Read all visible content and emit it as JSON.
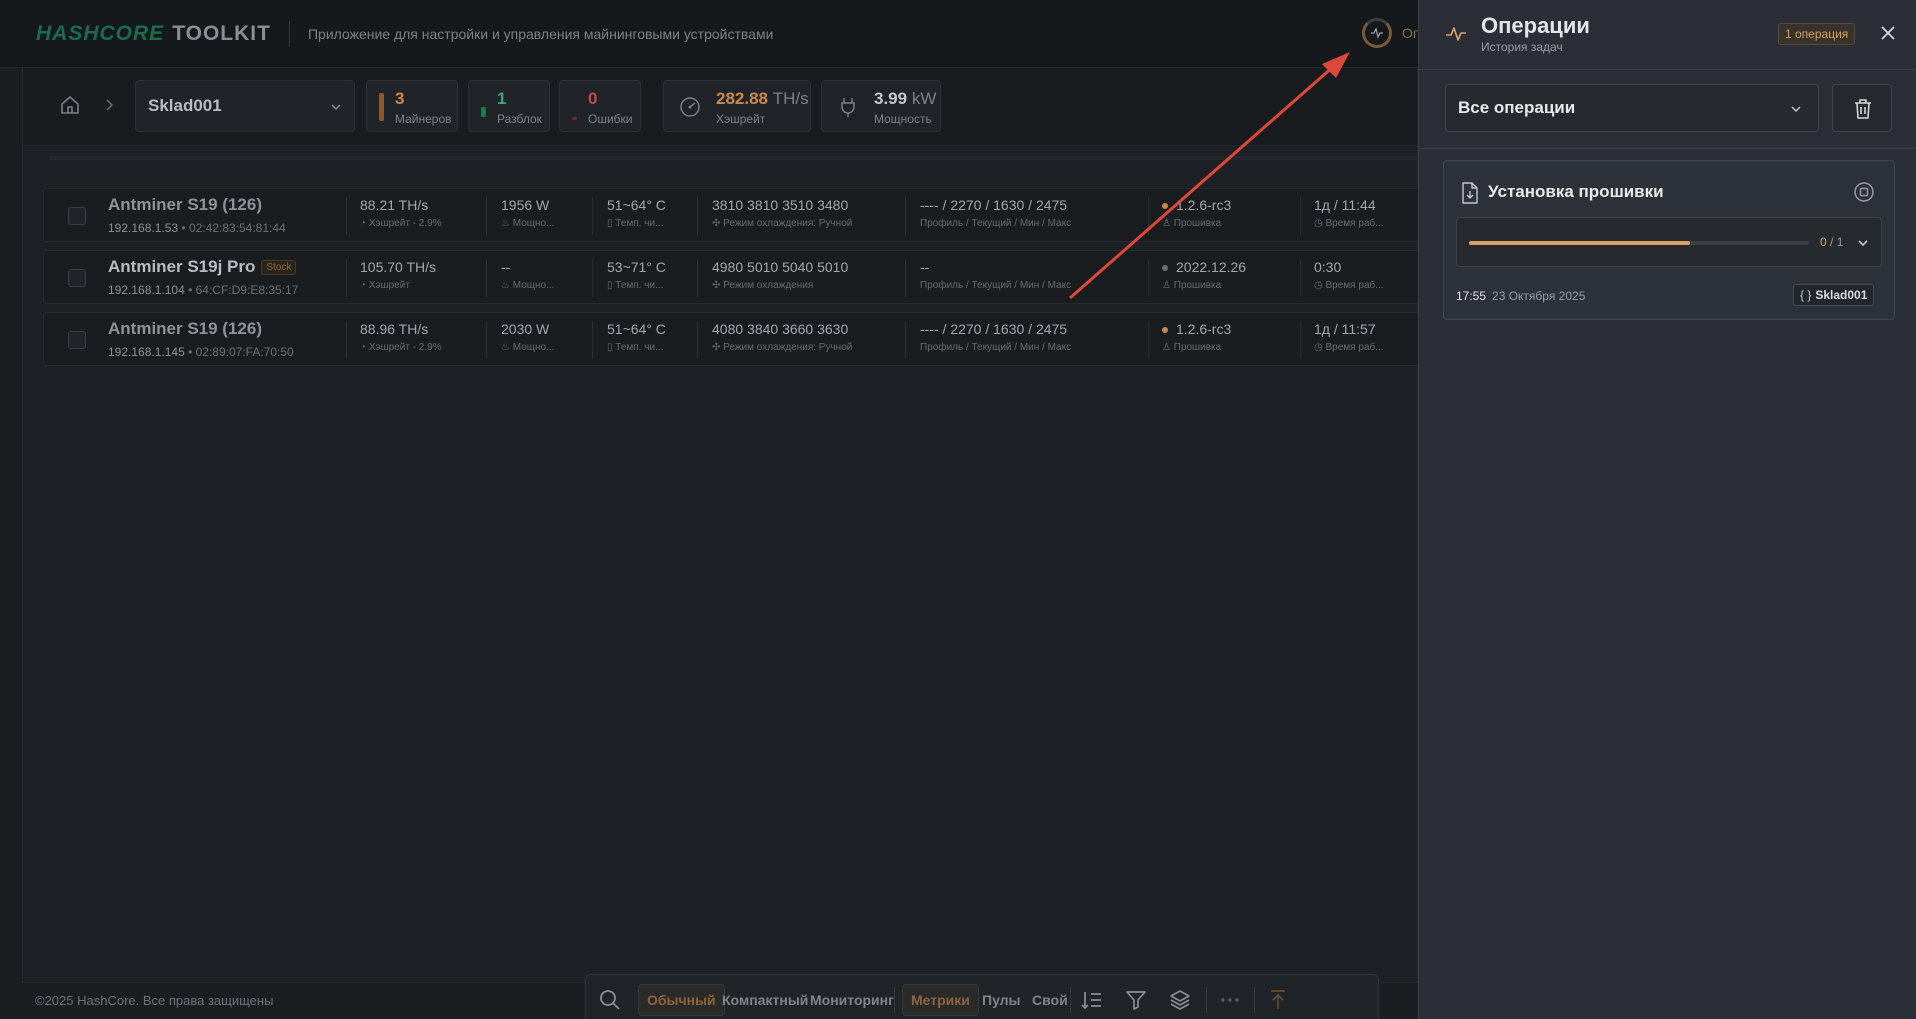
{
  "header": {
    "logo_primary": "HASHCORE",
    "logo_secondary": "TOOLKIT",
    "subtitle": "Приложение для настройки и управления майнинговыми устройствами",
    "ops_label": "Оп"
  },
  "breadcrumb": {
    "location": "Sklad001"
  },
  "stats": {
    "miners": {
      "value": "3",
      "label": "Майнеров",
      "color": "#c98a4a"
    },
    "unlocked": {
      "value": "1",
      "label": "Разблок",
      "color": "#3aa870"
    },
    "errors": {
      "value": "0",
      "label": "Ошибки",
      "color": "#c44a4a"
    },
    "hashrate": {
      "value": "282.88",
      "unit": "TH/s",
      "label": "Хэшрейт"
    },
    "power": {
      "value": "3.99",
      "unit": "kW",
      "label": "Мощность"
    }
  },
  "miners": [
    {
      "name": "Antminer S19 (126)",
      "badge": "",
      "ip": "192.168.1.53",
      "mac": "• 02:42:83:54:81:44",
      "hashrate": "88.21 TH/s",
      "hashrate_sub": "Хэшрейт - 2.9%",
      "power": "1956 W",
      "power_sub": "Мощно...",
      "temp": "51~64° C",
      "temp_sub": "Темп. чи...",
      "fans": "3810 3810 3510 3480",
      "fans_sub": "Режим охлаждения: Ручной",
      "profile": "---- / 2270 / 1630 / 2475",
      "profile_sub": "Профиль / Текущий / Мин / Макс",
      "firmware": "1.2.6-rc3",
      "firmware_sub": "Прошивка",
      "firmware_dot": "#c98a4a",
      "uptime": "1д / 11:44",
      "uptime_sub": "Время раб..."
    },
    {
      "name": "Antminer S19j Pro",
      "badge": "Stock",
      "ip": "192.168.1.104",
      "mac": "• 64:CF:D9:E8:35:17",
      "hashrate": "105.70 TH/s",
      "hashrate_sub": "Хэшрейт",
      "power": "--",
      "power_sub": "Мощно...",
      "temp": "53~71° C",
      "temp_sub": "Темп. чи...",
      "fans": "4980 5010 5040 5010",
      "fans_sub": "Режим охлаждения",
      "profile": "--",
      "profile_sub": "Профиль / Текущий / Мин / Макс",
      "firmware": "2022.12.26",
      "firmware_sub": "Прошивка",
      "firmware_dot": "#6a6e74",
      "uptime": "0:30",
      "uptime_sub": "Время раб..."
    },
    {
      "name": "Antminer S19 (126)",
      "badge": "",
      "ip": "192.168.1.145",
      "mac": "• 02:89:07:FA:70:50",
      "hashrate": "88.96 TH/s",
      "hashrate_sub": "Хэшрейт - 2.9%",
      "power": "2030 W",
      "power_sub": "Мощно...",
      "temp": "51~64° C",
      "temp_sub": "Темп. чи...",
      "fans": "4080 3840 3660 3630",
      "fans_sub": "Режим охлаждения: Ручной",
      "profile": "---- / 2270 / 1630 / 2475",
      "profile_sub": "Профиль / Текущий / Мин / Макс",
      "firmware": "1.2.6-rc3",
      "firmware_sub": "Прошивка",
      "firmware_dot": "#c98a4a",
      "uptime": "1д / 11:57",
      "uptime_sub": "Время раб..."
    }
  ],
  "toolbar": {
    "view_normal": "Обычный",
    "view_compact": "Компактный",
    "view_monitoring": "Мониторинг",
    "tab_metrics": "Метрики",
    "tab_pools": "Пулы",
    "tab_custom": "Свой"
  },
  "footer": {
    "copyright": "©2025 HashCore. Все права защищены"
  },
  "panel": {
    "title": "Операции",
    "subtitle": "История задач",
    "count_badge": "1 операция",
    "filter_value": "Все операции",
    "operation": {
      "title": "Установка прошивки",
      "progress_fraction": 0.65,
      "done": "0",
      "total": "/ 1",
      "time": "17:55",
      "date": "23 Октября 2025",
      "tag": "Sklad001"
    }
  },
  "colors": {
    "accent": "#d9a16a",
    "brand": "#1c6b4c",
    "annotation_arrow": "#e0473b"
  }
}
